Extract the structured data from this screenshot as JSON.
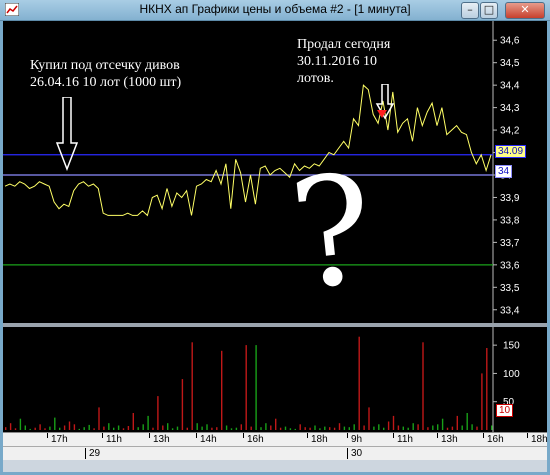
{
  "window": {
    "title": "НКНХ ап Графики цены и объема #2 - [1 минута]",
    "minimize_glyph": "–",
    "maximize_glyph": "□",
    "close_glyph": "✕"
  },
  "annotations": {
    "left_line1": "Купил под отсечку дивов",
    "left_line2": "26.04.16 10 лот (1000 шт)",
    "right_line1": "Продал сегодня",
    "right_line2": "30.11.2016  10",
    "right_line3": "лотов.",
    "question_mark": "?"
  },
  "price_badges": {
    "current": "34.09",
    "level": "34"
  },
  "volume_badge": "10",
  "chart_data": [
    {
      "type": "line",
      "name": "price",
      "y_ticks": [
        "34,6",
        "34,5",
        "34,4",
        "34,3",
        "34,2",
        "34,1",
        "34",
        "33,9",
        "33,8",
        "33,7",
        "33,6",
        "33,5",
        "33,4"
      ],
      "ylim": [
        33.35,
        34.65
      ],
      "horizontal_lines": [
        {
          "value": 34.09,
          "color": "#2a2aff"
        },
        {
          "value": 34.0,
          "color": "#8c8cff"
        },
        {
          "value": 33.6,
          "color": "#1aa21a"
        }
      ],
      "values": [
        33.95,
        33.96,
        33.95,
        33.97,
        33.96,
        33.94,
        33.95,
        33.97,
        33.96,
        33.95,
        33.88,
        33.85,
        33.87,
        33.86,
        33.93,
        33.96,
        33.97,
        33.95,
        33.96,
        33.94,
        33.83,
        33.82,
        33.82,
        33.82,
        33.82,
        33.83,
        33.82,
        33.82,
        33.84,
        33.82,
        33.9,
        33.91,
        33.85,
        33.94,
        33.86,
        33.92,
        33.9,
        33.93,
        33.82,
        33.95,
        33.96,
        33.98,
        33.97,
        34.02,
        33.96,
        34.05,
        33.85,
        34.07,
        34.01,
        33.88,
        34.0,
        33.87,
        34.03,
        34.04,
        34.0,
        34.02,
        34.03,
        34.01,
        33.99,
        34.05,
        34.02,
        34.04,
        34.03,
        34.05,
        34.04,
        34.07,
        34.1,
        34.09,
        34.12,
        34.15,
        34.12,
        34.25,
        34.22,
        34.4,
        34.38,
        34.27,
        34.23,
        34.33,
        34.2,
        34.37,
        34.19,
        34.23,
        34.25,
        34.15,
        34.3,
        34.22,
        34.28,
        34.32,
        34.22,
        34.3,
        34.18,
        34.2,
        34.22,
        34.19,
        34.18,
        34.1,
        34.05,
        34.09,
        34.02,
        34.09
      ],
      "line_color": "#ffff66"
    },
    {
      "type": "bar",
      "name": "volume",
      "y_ticks": [
        "150",
        "100",
        "50"
      ],
      "ylim": [
        0,
        175
      ],
      "values": [
        5,
        12,
        3,
        20,
        8,
        2,
        4,
        10,
        3,
        6,
        22,
        4,
        8,
        15,
        10,
        2,
        5,
        9,
        3,
        40,
        6,
        12,
        4,
        8,
        3,
        7,
        30,
        5,
        10,
        25,
        4,
        60,
        8,
        12,
        3,
        6,
        90,
        4,
        155,
        12,
        6,
        10,
        4,
        5,
        140,
        8,
        3,
        4,
        10,
        150,
        6,
        150,
        5,
        12,
        8,
        20,
        4,
        6,
        3,
        2,
        10,
        5,
        4,
        8,
        3,
        6,
        5,
        4,
        12,
        6,
        5,
        10,
        165,
        8,
        40,
        6,
        10,
        4,
        15,
        25,
        8,
        6,
        4,
        12,
        10,
        155,
        5,
        8,
        10,
        20,
        4,
        6,
        25,
        8,
        30,
        10,
        6,
        100,
        145,
        8
      ],
      "colors_pattern": [
        "#c01818",
        "#18a018"
      ]
    }
  ],
  "time_axis": {
    "hour_labels": [
      "17h",
      "11h",
      "13h",
      "14h",
      "16h",
      "18h",
      "9h",
      "11h",
      "13h",
      "16h",
      "18h"
    ],
    "date_labels": [
      "29",
      "30"
    ]
  }
}
